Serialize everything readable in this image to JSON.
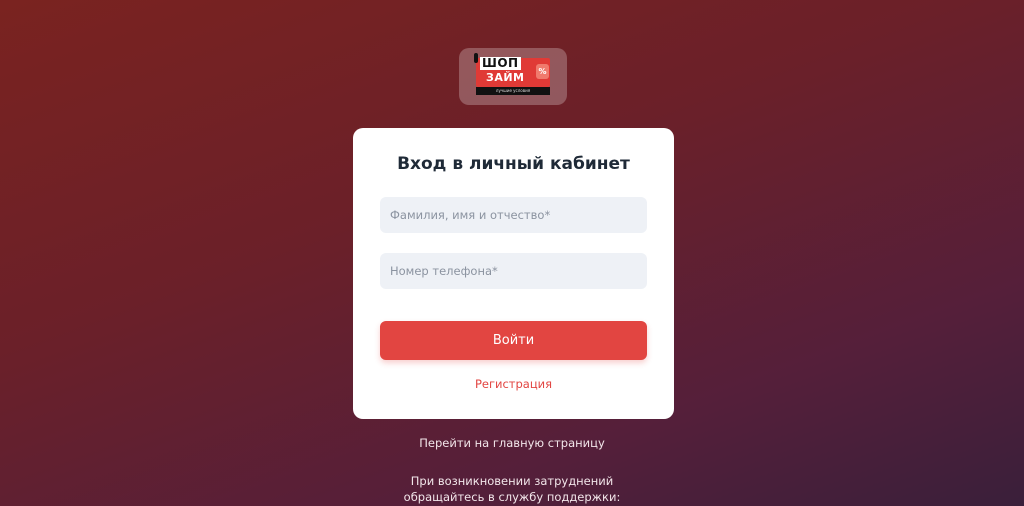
{
  "logo": {
    "line1": "ШОП",
    "line2": "ЗАЙМ",
    "tag": "%",
    "slogan": "лучшие условия"
  },
  "card": {
    "title": "Вход в личный кабинет",
    "name_placeholder": "Фамилия, имя и отчество*",
    "phone_placeholder": "Номер телефона*",
    "login_label": "Войти",
    "register_label": "Регистрация"
  },
  "footer": {
    "home_link": "Перейти на главную страницу",
    "support_line1": "При возникновении затруднений",
    "support_line2": "обращайтесь в службу поддержки:"
  },
  "colors": {
    "accent": "#e24541",
    "card_bg": "#ffffff",
    "field_bg": "#eef1f6"
  }
}
